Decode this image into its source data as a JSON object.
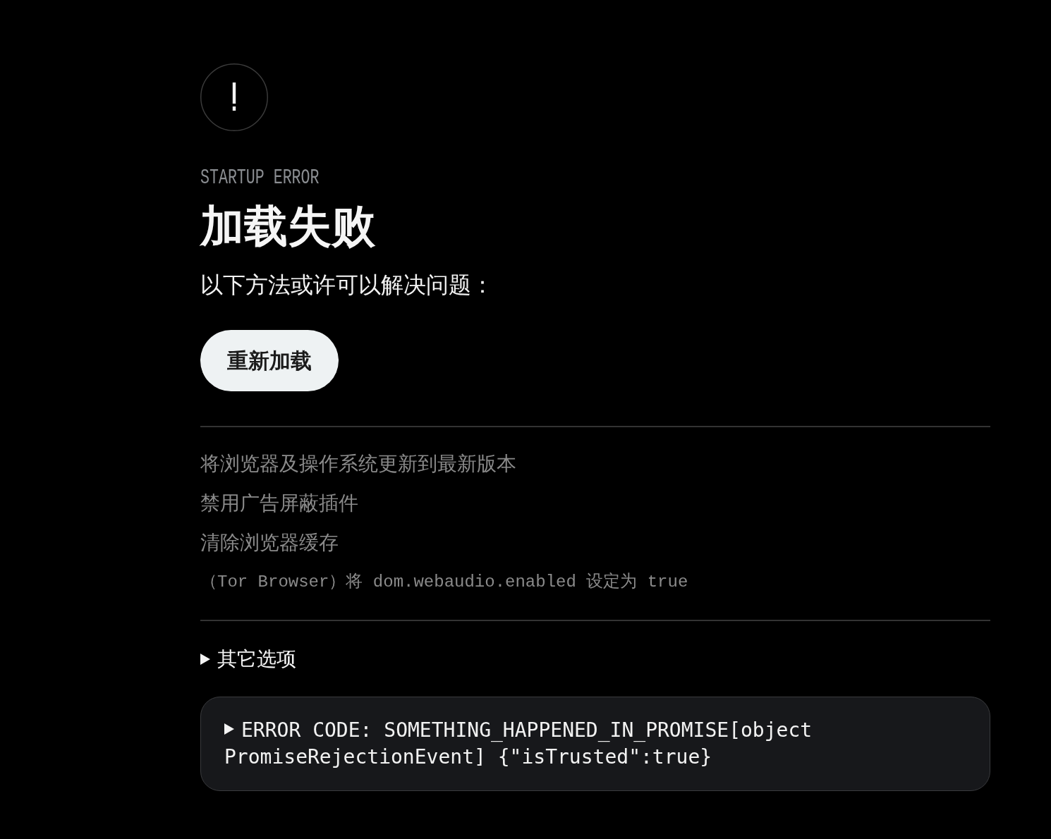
{
  "alert": {
    "eyebrow": "STARTUP ERROR",
    "title": "加载失败",
    "subtitle": "以下方法或许可以解决问题："
  },
  "reload_button": {
    "label": "重新加载"
  },
  "tips": [
    {
      "kind": "text",
      "text": "将浏览器及操作系统更新到最新版本"
    },
    {
      "kind": "text",
      "text": "禁用广告屏蔽插件"
    },
    {
      "kind": "text",
      "text": "清除浏览器缓存"
    },
    {
      "kind": "code",
      "text": "（Tor Browser）将 dom.webaudio.enabled 设定为 true"
    }
  ],
  "more_options": {
    "label": "其它选项",
    "expanded": false
  },
  "error_code": {
    "text": "ERROR CODE: SOMETHING_HAPPENED_IN_PROMISE[object PromiseRejectionEvent] {\"isTrusted\":true}",
    "expanded": false
  }
}
